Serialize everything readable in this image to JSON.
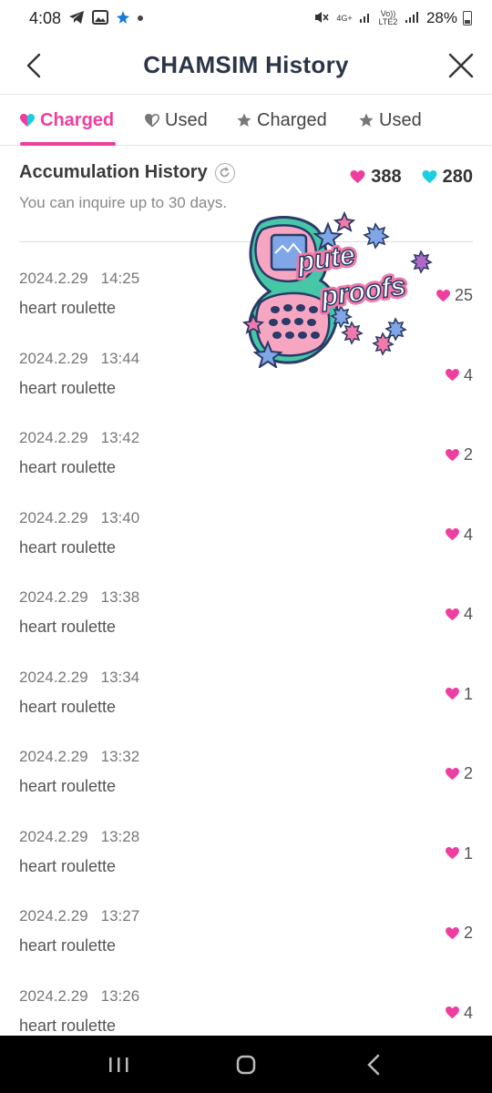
{
  "status_bar": {
    "time": "4:08",
    "network_4g": "4G+",
    "volte": "Vo)) LTE2",
    "battery": "28%",
    "icons": [
      "telegram-icon",
      "gallery-icon",
      "app-icon",
      "notification-dot",
      "mute-icon",
      "signal-icon",
      "battery-icon"
    ]
  },
  "header": {
    "title": "CHAMSIM History",
    "back_icon": "chevron-left-icon",
    "close_icon": "close-icon"
  },
  "tabs": [
    {
      "label": "Charged",
      "icon": "heart-icon",
      "active": true
    },
    {
      "label": "Used",
      "icon": "heart-outline-icon",
      "active": false
    },
    {
      "label": "Charged",
      "icon": "star-icon",
      "active": false
    },
    {
      "label": "Used",
      "icon": "star-icon",
      "active": false
    }
  ],
  "summary": {
    "title": "Accumulation History",
    "subtitle": "You can inquire up to 30 days.",
    "pink_total": "388",
    "cyan_total": "280"
  },
  "history": [
    {
      "date": "2024.2.29",
      "time": "14:25",
      "desc": "heart roulette",
      "amount": "25"
    },
    {
      "date": "2024.2.29",
      "time": "13:44",
      "desc": "heart roulette",
      "amount": "4"
    },
    {
      "date": "2024.2.29",
      "time": "13:42",
      "desc": "heart roulette",
      "amount": "2"
    },
    {
      "date": "2024.2.29",
      "time": "13:40",
      "desc": "heart roulette",
      "amount": "4"
    },
    {
      "date": "2024.2.29",
      "time": "13:38",
      "desc": "heart roulette",
      "amount": "4"
    },
    {
      "date": "2024.2.29",
      "time": "13:34",
      "desc": "heart roulette",
      "amount": "1"
    },
    {
      "date": "2024.2.29",
      "time": "13:32",
      "desc": "heart roulette",
      "amount": "2"
    },
    {
      "date": "2024.2.29",
      "time": "13:28",
      "desc": "heart roulette",
      "amount": "1"
    },
    {
      "date": "2024.2.29",
      "time": "13:27",
      "desc": "heart roulette",
      "amount": "2"
    },
    {
      "date": "2024.2.29",
      "time": "13:26",
      "desc": "heart roulette",
      "amount": "4"
    }
  ],
  "sticker": {
    "text": "pute proofs"
  },
  "colors": {
    "accent_pink": "#ee3e9f",
    "heart_cyan": "#1ccfe0",
    "title_navy": "#2c3548"
  }
}
